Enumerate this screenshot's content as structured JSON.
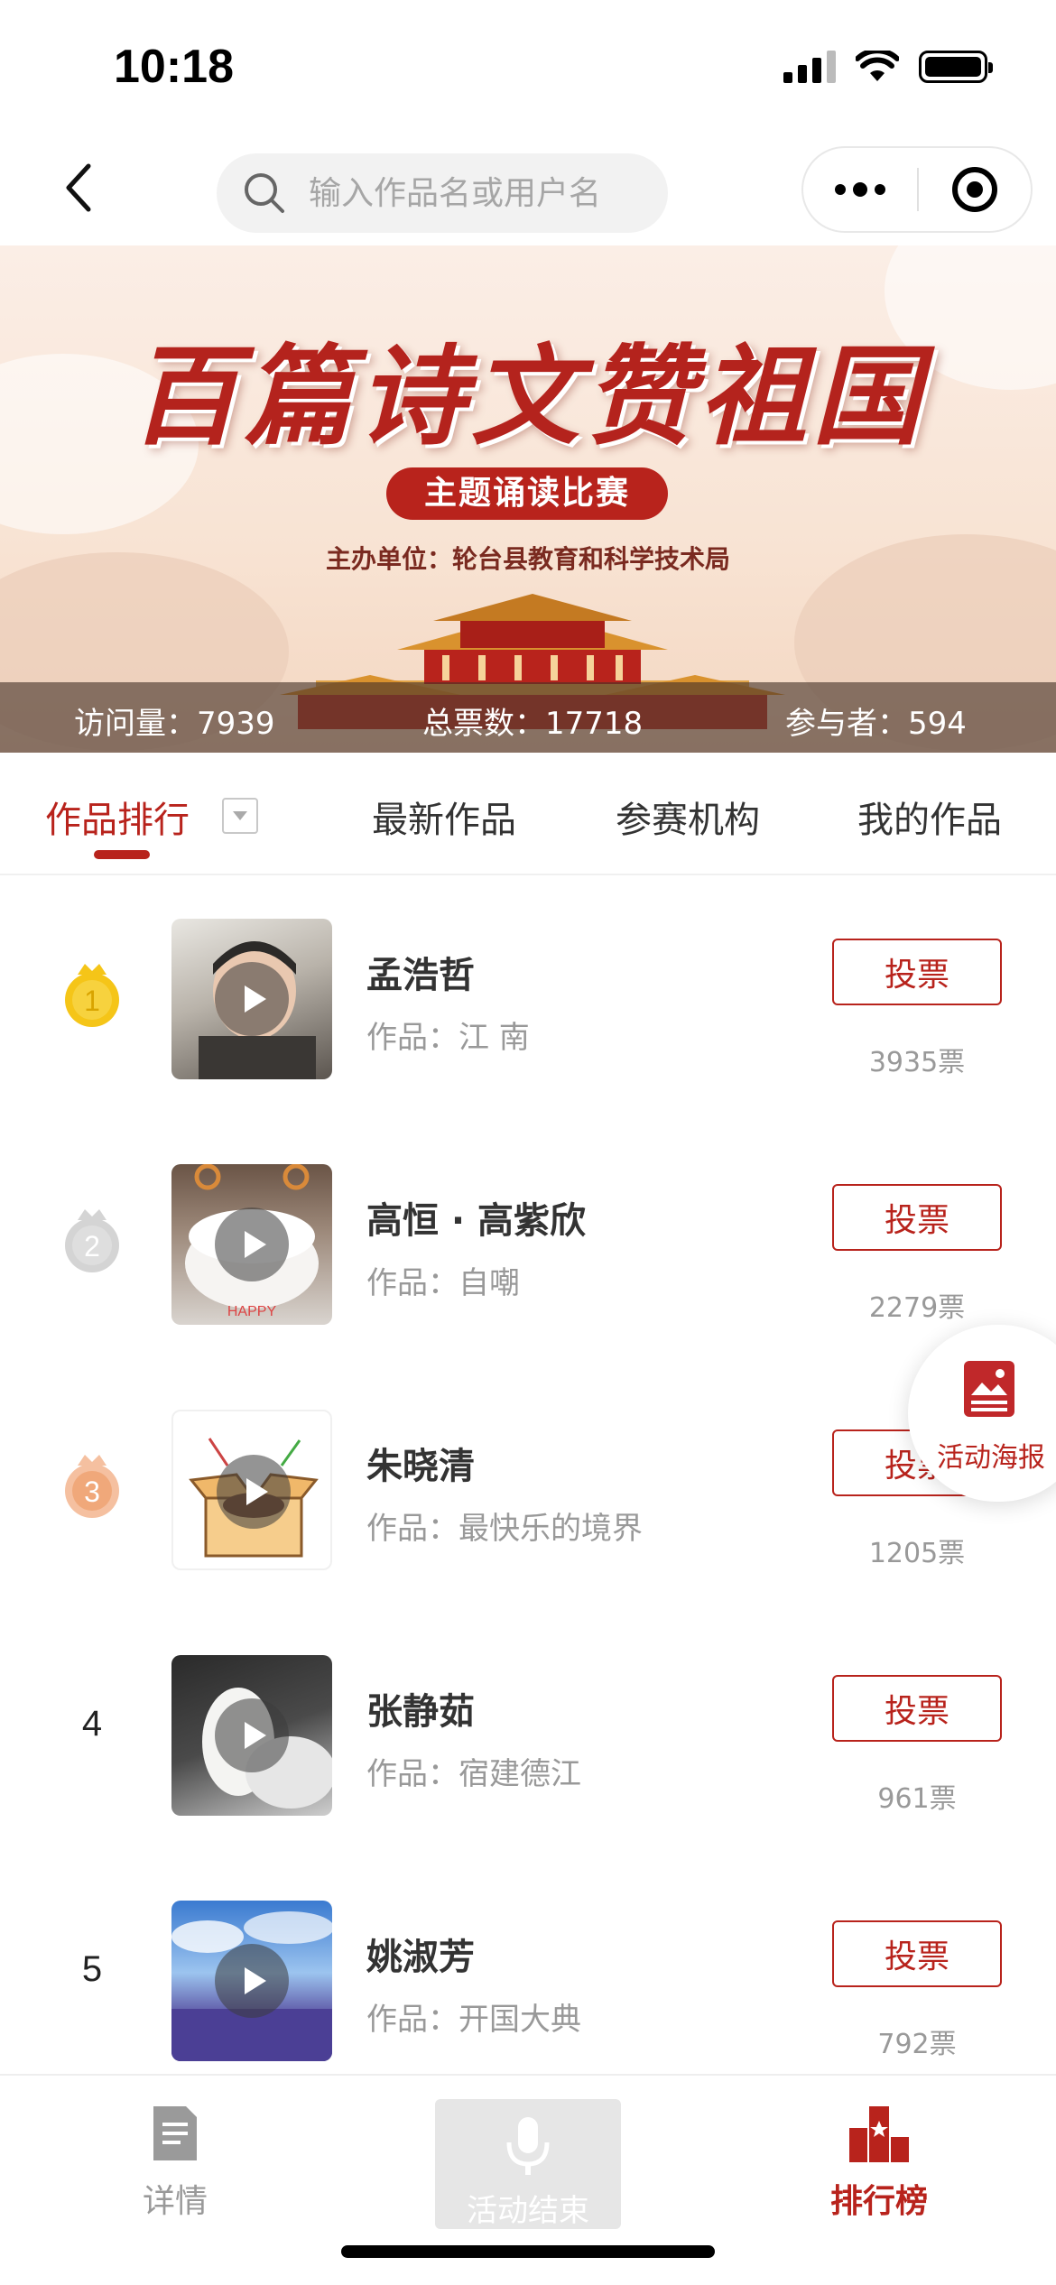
{
  "status_bar": {
    "time": "10:18"
  },
  "nav": {
    "search_placeholder": "输入作品名或用户名"
  },
  "banner": {
    "title": "百篇诗文赞祖国",
    "subtitle": "主题诵读比赛",
    "host": "主办单位：轮台县教育和科学技术局",
    "stats": {
      "visits": "访问量：7939",
      "total_votes": "总票数：17718",
      "participants": "参与者：594"
    }
  },
  "tabs": [
    {
      "label": "作品排行",
      "active": true
    },
    {
      "label": "最新作品"
    },
    {
      "label": "参赛机构"
    },
    {
      "label": "我的作品"
    }
  ],
  "vote_label": "投票",
  "rankings": [
    {
      "rank": "1",
      "name": "孟浩哲",
      "work": "作品：江 南",
      "votes": "3935票"
    },
    {
      "rank": "2",
      "name": "高恒 · 高紫欣",
      "work": "作品：自嘲",
      "votes": "2279票"
    },
    {
      "rank": "3",
      "name": "朱晓清",
      "work": "作品：最快乐的境界",
      "votes": "1205票"
    },
    {
      "rank": "4",
      "name": "张静茹",
      "work": "作品：宿建德江",
      "votes": "961票"
    },
    {
      "rank": "5",
      "name": "姚淑芳",
      "work": "作品：开国大典",
      "votes": "792票"
    }
  ],
  "poster_fab": {
    "label": "活动海报"
  },
  "bottom_bar": {
    "detail": "详情",
    "ended": "活动结束",
    "ranking": "排行榜"
  },
  "colors": {
    "accent": "#b8231c",
    "gold": "#f5c518",
    "silver": "#cfcfcf",
    "bronze": "#f0a87a"
  }
}
